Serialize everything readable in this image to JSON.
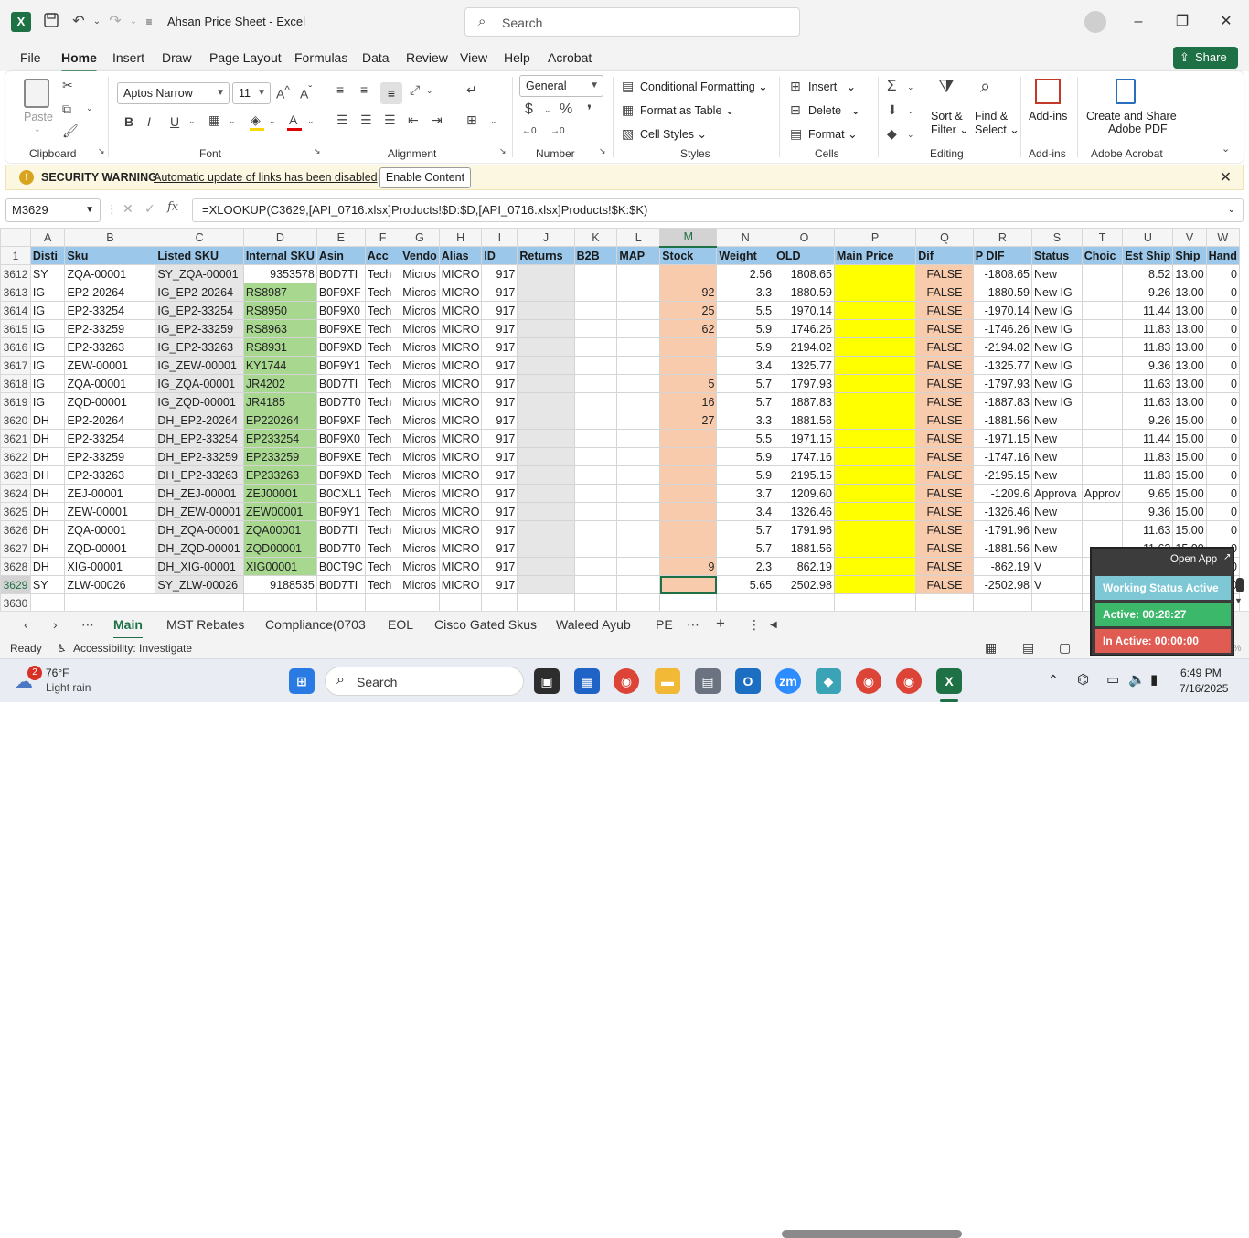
{
  "titlebar": {
    "title": "Ahsan Price Sheet  -  Excel",
    "search_placeholder": "Search",
    "excel_icon": "excel-icon"
  },
  "menu": {
    "tabs": [
      "File",
      "Home",
      "Insert",
      "Draw",
      "Page Layout",
      "Formulas",
      "Data",
      "Review",
      "View",
      "Help",
      "Acrobat"
    ],
    "share": "Share"
  },
  "ribbon": {
    "clipboard": {
      "paste": "Paste",
      "label": "Clipboard"
    },
    "font": {
      "name": "Aptos Narrow",
      "size": "11",
      "label": "Font"
    },
    "alignment": {
      "label": "Alignment"
    },
    "number": {
      "format": "General",
      "label": "Number"
    },
    "styles": {
      "cond": "Conditional Formatting",
      "table": "Format as Table",
      "cell": "Cell Styles",
      "label": "Styles"
    },
    "cells": {
      "insert": "Insert",
      "delete": "Delete",
      "format": "Format",
      "label": "Cells"
    },
    "editing": {
      "sort1": "Sort &",
      "sort2": "Filter",
      "find1": "Find &",
      "find2": "Select",
      "label": "Editing"
    },
    "addins": {
      "btn": "Add-ins",
      "label": "Add-ins"
    },
    "acrobat": {
      "btn1": "Create and Share",
      "btn2": "Adobe PDF",
      "label": "Adobe Acrobat"
    }
  },
  "security": {
    "title": "SECURITY WARNING",
    "message": "Automatic update of links has been disabled",
    "button": "Enable Content"
  },
  "formula_bar": {
    "cell": "M3629",
    "formula": "=XLOOKUP(C3629,[API_0716.xlsx]Products!$D:$D,[API_0716.xlsx]Products!$K:$K)"
  },
  "sheet": {
    "col_letters": [
      "A",
      "B",
      "C",
      "D",
      "E",
      "F",
      "G",
      "H",
      "I",
      "J",
      "K",
      "L",
      "M",
      "N",
      "O",
      "P",
      "Q",
      "R",
      "S",
      "T",
      "U",
      "V",
      "W"
    ],
    "header_row": "1",
    "headers": [
      "Disti",
      "Sku",
      "Listed SKU",
      "Internal SKU",
      "Asin",
      "Acc",
      "Vendo",
      "Alias",
      "ID",
      "Returns",
      "B2B",
      "MAP",
      "Stock",
      "Weight",
      "OLD",
      "Main Price",
      "Dif",
      "P DIF",
      "Status",
      "Choic",
      "Est Ship",
      "Ship",
      "Hand"
    ],
    "rows": [
      {
        "n": "3612",
        "c": [
          "SY",
          "ZQA-00001",
          "SY_ZQA-00001",
          "9353578",
          "B0D7TI",
          "Tech",
          "Micros",
          "MICRO",
          "917",
          "",
          "",
          "",
          "",
          "2.56",
          "1808.65",
          "",
          "FALSE",
          "-1808.65",
          "New",
          "",
          "8.52",
          "13.00",
          "0"
        ]
      },
      {
        "n": "3613",
        "c": [
          "IG",
          "EP2-20264",
          "IG_EP2-20264",
          "RS8987",
          "B0F9XF",
          "Tech",
          "Micros",
          "MICRO",
          "917",
          "",
          "",
          "",
          "92",
          "3.3",
          "1880.59",
          "",
          "FALSE",
          "-1880.59",
          "New IG",
          "",
          "9.26",
          "13.00",
          "0"
        ]
      },
      {
        "n": "3614",
        "c": [
          "IG",
          "EP2-33254",
          "IG_EP2-33254",
          "RS8950",
          "B0F9X0",
          "Tech",
          "Micros",
          "MICRO",
          "917",
          "",
          "",
          "",
          "25",
          "5.5",
          "1970.14",
          "",
          "FALSE",
          "-1970.14",
          "New IG",
          "",
          "11.44",
          "13.00",
          "0"
        ]
      },
      {
        "n": "3615",
        "c": [
          "IG",
          "EP2-33259",
          "IG_EP2-33259",
          "RS8963",
          "B0F9XE",
          "Tech",
          "Micros",
          "MICRO",
          "917",
          "",
          "",
          "",
          "62",
          "5.9",
          "1746.26",
          "",
          "FALSE",
          "-1746.26",
          "New IG",
          "",
          "11.83",
          "13.00",
          "0"
        ]
      },
      {
        "n": "3616",
        "c": [
          "IG",
          "EP2-33263",
          "IG_EP2-33263",
          "RS8931",
          "B0F9XD",
          "Tech",
          "Micros",
          "MICRO",
          "917",
          "",
          "",
          "",
          "",
          "5.9",
          "2194.02",
          "",
          "FALSE",
          "-2194.02",
          "New IG",
          "",
          "11.83",
          "13.00",
          "0"
        ]
      },
      {
        "n": "3617",
        "c": [
          "IG",
          "ZEW-00001",
          "IG_ZEW-00001",
          "KY1744",
          "B0F9Y1",
          "Tech",
          "Micros",
          "MICRO",
          "917",
          "",
          "",
          "",
          "",
          "3.4",
          "1325.77",
          "",
          "FALSE",
          "-1325.77",
          "New IG",
          "",
          "9.36",
          "13.00",
          "0"
        ]
      },
      {
        "n": "3618",
        "c": [
          "IG",
          "ZQA-00001",
          "IG_ZQA-00001",
          "JR4202",
          "B0D7TI",
          "Tech",
          "Micros",
          "MICRO",
          "917",
          "",
          "",
          "",
          "5",
          "5.7",
          "1797.93",
          "",
          "FALSE",
          "-1797.93",
          "New IG",
          "",
          "11.63",
          "13.00",
          "0"
        ]
      },
      {
        "n": "3619",
        "c": [
          "IG",
          "ZQD-00001",
          "IG_ZQD-00001",
          "JR4185",
          "B0D7T0",
          "Tech",
          "Micros",
          "MICRO",
          "917",
          "",
          "",
          "",
          "16",
          "5.7",
          "1887.83",
          "",
          "FALSE",
          "-1887.83",
          "New IG",
          "",
          "11.63",
          "13.00",
          "0"
        ]
      },
      {
        "n": "3620",
        "c": [
          "DH",
          "EP2-20264",
          "DH_EP2-20264",
          "EP220264",
          "B0F9XF",
          "Tech",
          "Micros",
          "MICRO",
          "917",
          "",
          "",
          "",
          "27",
          "3.3",
          "1881.56",
          "",
          "FALSE",
          "-1881.56",
          "New",
          "",
          "9.26",
          "15.00",
          "0"
        ]
      },
      {
        "n": "3621",
        "c": [
          "DH",
          "EP2-33254",
          "DH_EP2-33254",
          "EP233254",
          "B0F9X0",
          "Tech",
          "Micros",
          "MICRO",
          "917",
          "",
          "",
          "",
          "",
          "5.5",
          "1971.15",
          "",
          "FALSE",
          "-1971.15",
          "New",
          "",
          "11.44",
          "15.00",
          "0"
        ]
      },
      {
        "n": "3622",
        "c": [
          "DH",
          "EP2-33259",
          "DH_EP2-33259",
          "EP233259",
          "B0F9XE",
          "Tech",
          "Micros",
          "MICRO",
          "917",
          "",
          "",
          "",
          "",
          "5.9",
          "1747.16",
          "",
          "FALSE",
          "-1747.16",
          "New",
          "",
          "11.83",
          "15.00",
          "0"
        ]
      },
      {
        "n": "3623",
        "c": [
          "DH",
          "EP2-33263",
          "DH_EP2-33263",
          "EP233263",
          "B0F9XD",
          "Tech",
          "Micros",
          "MICRO",
          "917",
          "",
          "",
          "",
          "",
          "5.9",
          "2195.15",
          "",
          "FALSE",
          "-2195.15",
          "New",
          "",
          "11.83",
          "15.00",
          "0"
        ]
      },
      {
        "n": "3624",
        "c": [
          "DH",
          "ZEJ-00001",
          "DH_ZEJ-00001",
          "ZEJ00001",
          "B0CXL1",
          "Tech",
          "Micros",
          "MICRO",
          "917",
          "",
          "",
          "",
          "",
          "3.7",
          "1209.60",
          "",
          "FALSE",
          "-1209.6",
          "Approva",
          "Approv",
          "9.65",
          "15.00",
          "0"
        ]
      },
      {
        "n": "3625",
        "c": [
          "DH",
          "ZEW-00001",
          "DH_ZEW-00001",
          "ZEW00001",
          "B0F9Y1",
          "Tech",
          "Micros",
          "MICRO",
          "917",
          "",
          "",
          "",
          "",
          "3.4",
          "1326.46",
          "",
          "FALSE",
          "-1326.46",
          "New",
          "",
          "9.36",
          "15.00",
          "0"
        ]
      },
      {
        "n": "3626",
        "c": [
          "DH",
          "ZQA-00001",
          "DH_ZQA-00001",
          "ZQA00001",
          "B0D7TI",
          "Tech",
          "Micros",
          "MICRO",
          "917",
          "",
          "",
          "",
          "",
          "5.7",
          "1791.96",
          "",
          "FALSE",
          "-1791.96",
          "New",
          "",
          "11.63",
          "15.00",
          "0"
        ]
      },
      {
        "n": "3627",
        "c": [
          "DH",
          "ZQD-00001",
          "DH_ZQD-00001",
          "ZQD00001",
          "B0D7T0",
          "Tech",
          "Micros",
          "MICRO",
          "917",
          "",
          "",
          "",
          "",
          "5.7",
          "1881.56",
          "",
          "FALSE",
          "-1881.56",
          "New",
          "",
          "11.63",
          "15.00",
          "0"
        ]
      },
      {
        "n": "3628",
        "c": [
          "DH",
          "XIG-00001",
          "DH_XIG-00001",
          "XIG00001",
          "B0CT9C",
          "Tech",
          "Micros",
          "MICRO",
          "917",
          "",
          "",
          "",
          "9",
          "2.3",
          "862.19",
          "",
          "FALSE",
          "-862.19",
          "V",
          "",
          "",
          "",
          "0"
        ]
      },
      {
        "n": "3629",
        "c": [
          "SY",
          "ZLW-00026",
          "SY_ZLW-00026",
          "9188535",
          "B0D7TI",
          "Tech",
          "Micros",
          "MICRO",
          "917",
          "",
          "",
          "",
          "",
          "5.65",
          "2502.98",
          "",
          "FALSE",
          "-2502.98",
          "V",
          "",
          "",
          "",
          "0"
        ]
      }
    ],
    "last_row": "3630"
  },
  "tabs": [
    "Main",
    "MST Rebates",
    "Compliance(0703",
    "EOL",
    "Cisco Gated Skus",
    "Waleed Ayub",
    "PE"
  ],
  "status": {
    "ready": "Ready",
    "accessibility": "Accessibility: Investigate",
    "zoom": "100%"
  },
  "overlay": {
    "open_app": "Open App",
    "working": "Working Status Active",
    "active": "Active: 00:28:27",
    "inactive": "In Active: 00:00:00"
  },
  "taskbar": {
    "weather_temp": "76°F",
    "weather_desc": "Light rain",
    "badge": "2",
    "search": "Search",
    "time": "6:49 PM",
    "date": "7/16/2025"
  }
}
